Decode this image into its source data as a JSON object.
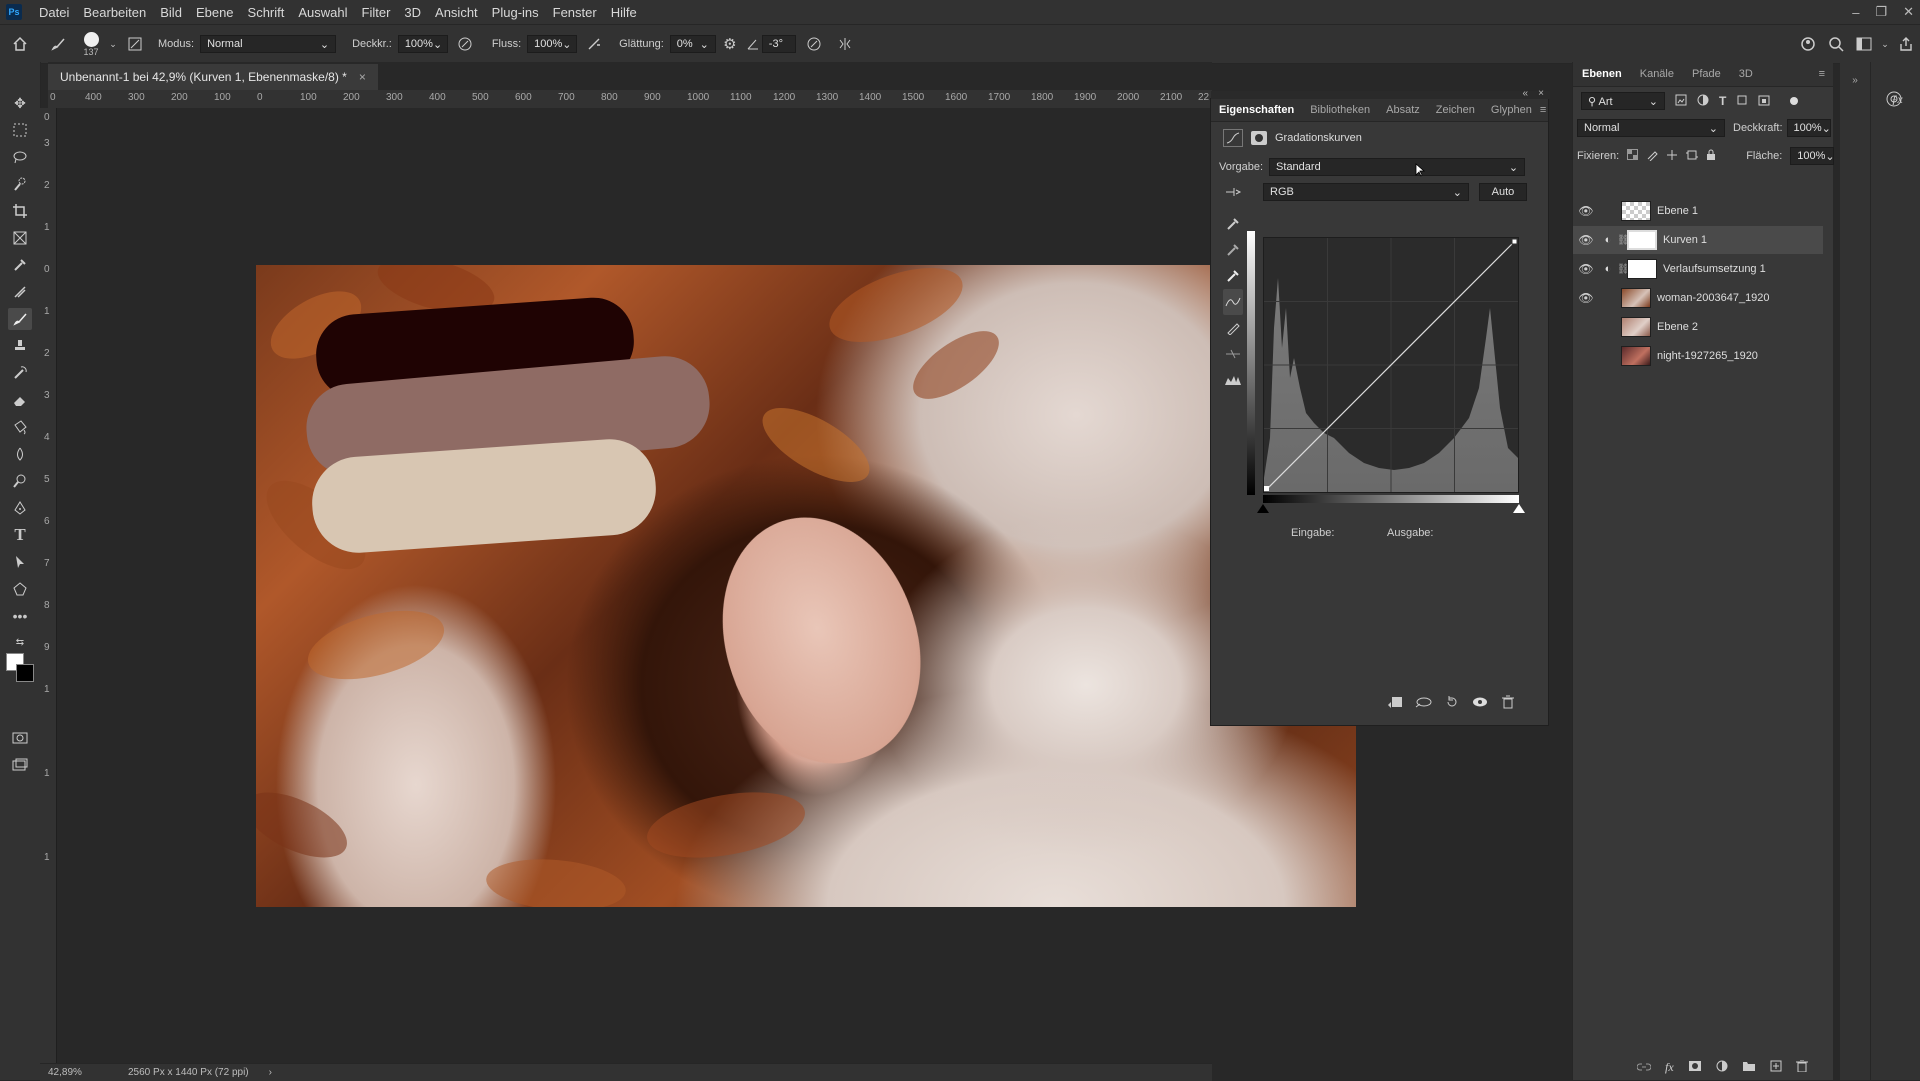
{
  "app": {
    "logo": "Ps"
  },
  "menu": [
    "Datei",
    "Bearbeiten",
    "Bild",
    "Ebene",
    "Schrift",
    "Auswahl",
    "Filter",
    "3D",
    "Ansicht",
    "Plug-ins",
    "Fenster",
    "Hilfe"
  ],
  "window_controls": {
    "minimize": "–",
    "restore": "❐",
    "close": "✕"
  },
  "options": {
    "brush_size": "137",
    "mode_label": "Modus:",
    "mode_value": "Normal",
    "opacity_label": "Deckkr.:",
    "opacity_value": "100%",
    "flow_label": "Fluss:",
    "flow_value": "100%",
    "smoothing_label": "Glättung:",
    "smoothing_value": "0%",
    "angle_value": "-3°"
  },
  "document": {
    "tab_title": "Unbenannt-1 bei 42,9% (Kurven 1, Ebenenmaske/8) *",
    "close": "×"
  },
  "ruler": {
    "h_labels": [
      "0",
      "400",
      "300",
      "200",
      "100",
      "0",
      "100",
      "200",
      "300",
      "400",
      "500",
      "600",
      "700",
      "800",
      "900",
      "1000",
      "1100",
      "1200",
      "1300",
      "1400",
      "1500",
      "1600",
      "1700",
      "1800",
      "1900",
      "2000",
      "2100",
      "22"
    ],
    "v_labels": [
      "0",
      "3",
      "2",
      "1",
      "0",
      "1",
      "2",
      "3",
      "4",
      "5",
      "6",
      "7",
      "8",
      "9",
      "1",
      "1",
      "1"
    ]
  },
  "properties": {
    "tabs": [
      "Eigenschaften",
      "Bibliotheken",
      "Absatz",
      "Zeichen",
      "Glyphen"
    ],
    "title": "Gradationskurven",
    "preset_label": "Vorgabe:",
    "preset_value": "Standard",
    "channel_value": "RGB",
    "auto_label": "Auto",
    "input_label": "Eingabe:",
    "output_label": "Ausgabe:"
  },
  "layers_panel": {
    "tabs": [
      "Ebenen",
      "Kanäle",
      "Pfade",
      "3D"
    ],
    "filter_value": "Art",
    "blend_mode": "Normal",
    "opacity_label": "Deckkraft:",
    "opacity_value": "100%",
    "lock_label": "Fixieren:",
    "fill_label": "Fläche:",
    "fill_value": "100%",
    "layers": [
      {
        "name": "Ebene 1",
        "visible": true
      },
      {
        "name": "Kurven 1",
        "visible": true,
        "selected": true
      },
      {
        "name": "Verlaufsumsetzung 1",
        "visible": true
      },
      {
        "name": "woman-2003647_1920",
        "visible": true
      },
      {
        "name": "Ebene 2",
        "visible": false
      },
      {
        "name": "night-1927265_1920",
        "visible": false
      }
    ]
  },
  "status": {
    "zoom": "42,89%",
    "doc_size": "2560 Px x 1440 Px (72 ppi)",
    "arrow": "›"
  },
  "colors": {
    "swatch_dark": "#1f0303",
    "swatch_mid": "#8f6b64",
    "swatch_light": "#d8c6b2",
    "accent": "#31a8ff"
  }
}
